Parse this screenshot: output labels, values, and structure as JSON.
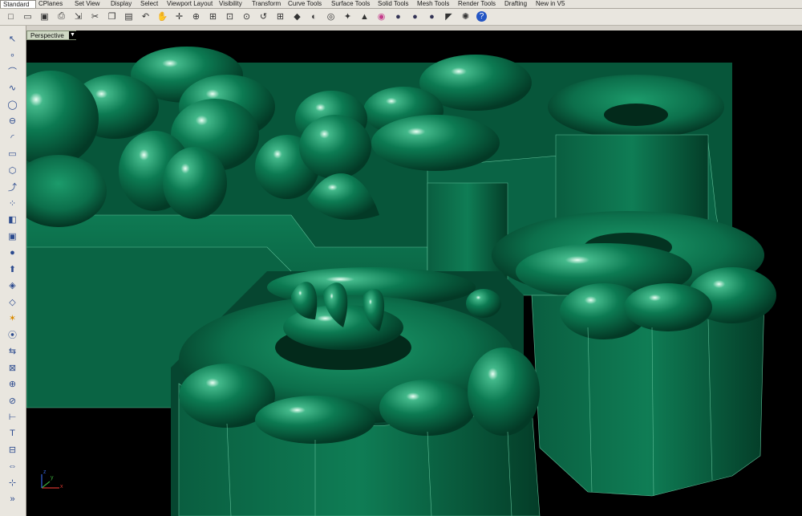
{
  "tabs": [
    {
      "label": "Standard",
      "active": true
    },
    {
      "label": "CPlanes"
    },
    {
      "label": "Set View"
    },
    {
      "label": "Display"
    },
    {
      "label": "Select"
    },
    {
      "label": "Viewport Layout"
    },
    {
      "label": "Visibility"
    },
    {
      "label": "Transform"
    },
    {
      "label": "Curve Tools"
    },
    {
      "label": "Surface Tools"
    },
    {
      "label": "Solid Tools"
    },
    {
      "label": "Mesh Tools"
    },
    {
      "label": "Render Tools"
    },
    {
      "label": "Drafting"
    },
    {
      "label": "New in V5"
    }
  ],
  "toolbar_icons": [
    "new-file-icon",
    "open-file-icon",
    "save-icon",
    "print-icon",
    "import-icon",
    "cut-icon",
    "copy-icon",
    "paste-icon",
    "undo-icon",
    "pan-icon",
    "rotate-view-icon",
    "zoom-icon",
    "zoom-window-icon",
    "zoom-extents-icon",
    "zoom-selected-icon",
    "undo-view-icon",
    "four-viewports-icon",
    "layer-icon",
    "object-properties-icon",
    "select-all-icon",
    "lightbulb-icon",
    "lock-icon",
    "color-icon",
    "render-sphere-icon",
    "material-sphere-icon",
    "environment-sphere-icon",
    "options-icon",
    "settings-icon",
    "help-icon"
  ],
  "left_tools": [
    "select-arrow-icon",
    "point-icon",
    "polyline-icon",
    "curve-icon",
    "circle-icon",
    "ellipse-icon",
    "arc-icon",
    "rectangle-icon",
    "polygon-icon",
    "curve-from-object-icon",
    "edit-points-icon",
    "surface-icon",
    "box-solid-icon",
    "sphere-solid-icon",
    "extrude-icon",
    "boolean-icon",
    "mesh-icon",
    "render-light-icon",
    "analysis-icon",
    "dimension-icon",
    "group-icon",
    "join-icon",
    "explode-icon",
    "trim-icon",
    "text-icon",
    "block-icon",
    "transform-icon",
    "snap-icon",
    "more-tools-icon"
  ],
  "viewport": {
    "label": "Perspective",
    "model_color": "#0b6b4a",
    "background": "#000000"
  },
  "axis": {
    "x_label": "x",
    "y_label": "y",
    "z_label": "z"
  }
}
